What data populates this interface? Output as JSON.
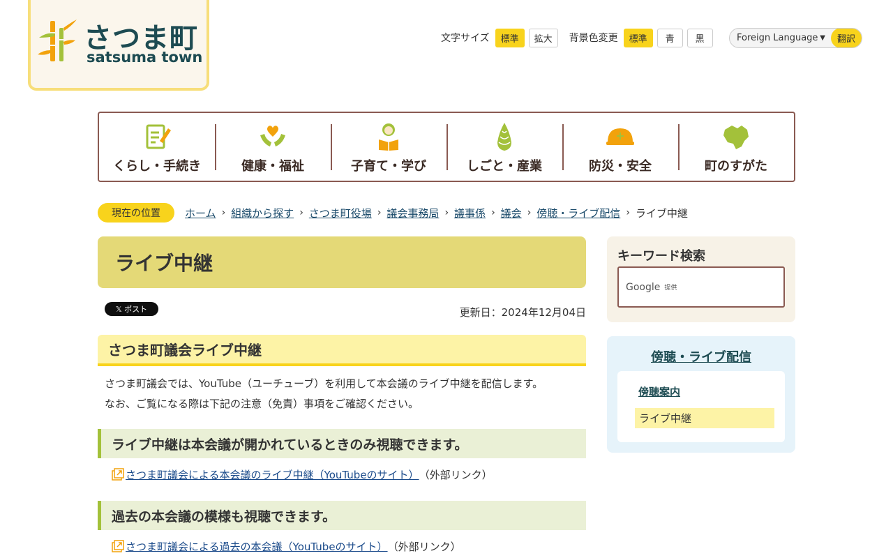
{
  "logo": {
    "ja": "さつま町",
    "en": "satsuma town"
  },
  "tools": {
    "font_size_label": "文字サイズ",
    "font_standard": "標準",
    "font_large": "拡大",
    "bg_label": "背景色変更",
    "bg_standard": "標準",
    "bg_blue": "青",
    "bg_black": "黒",
    "foreign_language": "Foreign Language",
    "translate": "翻訳",
    "accent": "#f8d31c"
  },
  "gnav": [
    {
      "label": "くらし・手続き",
      "icon": "form-pen-icon"
    },
    {
      "label": "健康・福祉",
      "icon": "hands-heart-icon"
    },
    {
      "label": "子育て・学び",
      "icon": "child-book-icon"
    },
    {
      "label": "しごと・産業",
      "icon": "bamboo-shoot-icon"
    },
    {
      "label": "防災・安全",
      "icon": "helmet-icon"
    },
    {
      "label": "町のすがた",
      "icon": "town-map-icon"
    }
  ],
  "breadcrumb": {
    "here": "現在の位置",
    "items": [
      "ホーム",
      "組織から探す",
      "さつま町役場",
      "議会事務局",
      "議事係",
      "議会",
      "傍聴・ライブ配信"
    ],
    "current": "ライブ中継"
  },
  "main": {
    "title": "ライブ中継",
    "x_post": "𝕏 ポスト",
    "updated": "更新日：2024年12月04日",
    "section_title": "さつま町議会ライブ中継",
    "intro_1": "さつま町議会では、YouTube（ユーチューブ）を利用して本会議のライブ中継を配信します。",
    "intro_2": "なお、ご覧になる際は下記の注意（免責）事項をご確認ください。",
    "h3_live": "ライブ中継は本会議が開かれているときのみ視聴できます。",
    "link_live": "さつま町議会による本会議のライブ中継（YouTubeのサイト）",
    "external_note_1": "（外部リンク）",
    "h3_past": "過去の本会議の模様も視聴できます。",
    "link_past": "さつま町議会による過去の本会議（YouTubeのサイト）",
    "external_note_2": "（外部リンク）"
  },
  "sidebar": {
    "search_title": "キーワード検索",
    "google": "Google",
    "google_provided": "提供",
    "nav_title": "傍聴・ライブ配信",
    "nav_items": [
      "傍聴案内",
      "ライブ中継"
    ]
  }
}
